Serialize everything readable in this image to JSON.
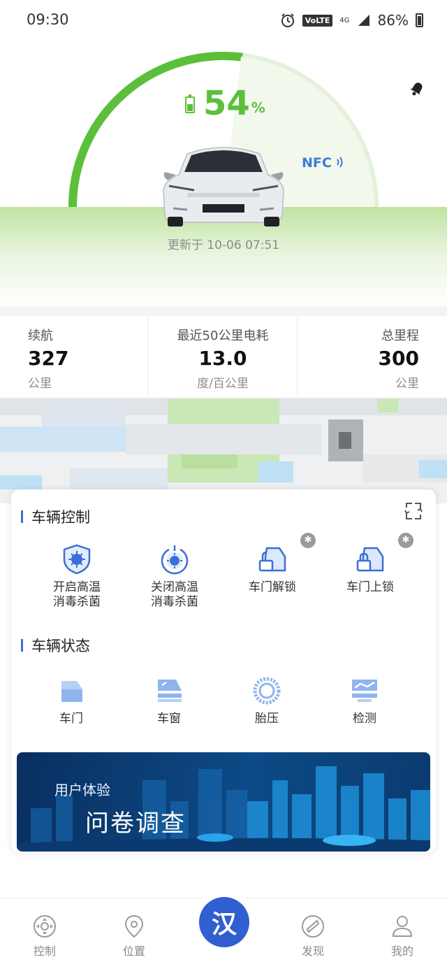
{
  "status_bar": {
    "time": "09:30",
    "volte": "VoLTE",
    "network": "4G",
    "battery": "86%"
  },
  "hero": {
    "soc_value": "54",
    "soc_unit": "%",
    "soc_level": 0.54,
    "nfc_label": "NFC",
    "update_time": "更新于 10-06 07:51",
    "gauge_color": "#5cbf3c"
  },
  "stats": [
    {
      "label": "续航",
      "value": "327",
      "unit": "公里"
    },
    {
      "label": "最近50公里电耗",
      "value": "13.0",
      "unit": "度/百公里"
    },
    {
      "label": "总里程",
      "value": "300",
      "unit": "公里"
    }
  ],
  "vehicle_control": {
    "title": "车辆控制",
    "items": [
      {
        "line1": "开启高温",
        "line2": "消毒杀菌",
        "icon": "sterilize-on-icon"
      },
      {
        "line1": "关闭高温",
        "line2": "消毒杀菌",
        "icon": "sterilize-off-icon"
      },
      {
        "line1": "车门解锁",
        "line2": "",
        "icon": "door-unlock-icon"
      },
      {
        "line1": "车门上锁",
        "line2": "",
        "icon": "door-lock-icon"
      }
    ]
  },
  "vehicle_status": {
    "title": "车辆状态",
    "items": [
      {
        "label": "车门",
        "icon": "door-icon"
      },
      {
        "label": "车窗",
        "icon": "window-icon"
      },
      {
        "label": "胎压",
        "icon": "tire-icon"
      },
      {
        "label": "检测",
        "icon": "inspection-icon"
      }
    ]
  },
  "banner": {
    "subtitle": "用户体验",
    "title": "问卷调查"
  },
  "bottom_nav": {
    "items": [
      {
        "label": "控制",
        "icon": "dpad-icon"
      },
      {
        "label": "位置",
        "icon": "location-pin-icon"
      },
      {
        "label": "发现",
        "icon": "compass-icon"
      },
      {
        "label": "我的",
        "icon": "user-icon"
      }
    ],
    "center_label": "汉",
    "accent": "#2f5fd0"
  }
}
